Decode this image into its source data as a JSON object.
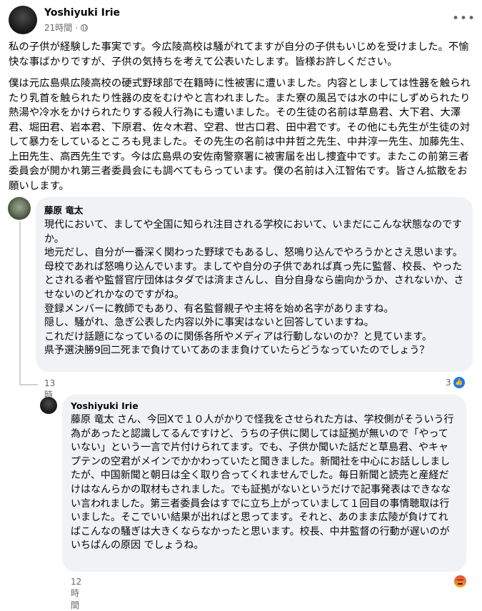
{
  "post": {
    "author": "Yoshiyuki Irie",
    "time": "21時間",
    "more_icon": "ellipsis-icon",
    "paragraphs": [
      "私の子供が経験した事実です。今広陵高校は騒がれてますが自分の子供もいじめを受けました。不愉快な事ばかりですが、子供の気持ちを考えて公表いたします。皆様お許しください。",
      "僕は元広島県広陵高校の硬式野球部で在籍時に性被害に遭いました。内容としましては性器を触られたり乳首を触られたり性器の皮をむけやと言われました。また寮の風呂では水の中にしずめられたり熱湯や冷水をかけられたりする殺人行為にも遭いました。その生徒の名前は草島君、大下君、大澤君、堀田君、岩本君、下原君、佐々木君、空君、世古口君、田中君です。その他にも先生が生徒の対して暴力をしているところも見ました。その先生の名前は中井哲之先生、中井淳一先生、加藤先生、上田先生、高西先生です。今は広島県の安佐南警察署に被害届を出し捜査中です。またこの前第三者委員会が開かれ第三者委員会にも調べてもらっています。僕の名前は入江智佑です。皆さん拡散をお願いします。"
    ]
  },
  "comments": [
    {
      "name": "藤原 竜太",
      "text": "現代において、ましてや全国に知られ注目される学校において、いまだにこんな状態なのですか。\n地元だし、自分が一番深く関わった野球でもあるし、怒鳴り込んでやろうかとさえ思います。母校であれば怒鳴り込んでいます。ましてや自分の子供であれば真っ先に監督、校長、やったとされる者や監督官庁団体はタダでは済まさんし、自分自身なら歯向かうか、されないか、させないのどれかなのですがね。\n登録メンバーに教師でもあり、有名監督親子や主将を始め名字がありますね。\n隠し、騒がれ、急ぎ公表した内容以外に事実はないと回答していますね。\nこれだけ話題になっているのに関係各所やメディアは行動しないのか？と見ています。\n県予選決勝9回二死まで負けていてあのまま負けていたらどうなっていたのでしょう？",
      "time": "13時間",
      "reaction_count": "3",
      "reaction_icon": "like-icon"
    },
    {
      "name": "Yoshiyuki Irie",
      "text": "藤原 竜太 さん、今回Xで１０人がかりで怪我をさせられた方は、学校側がそういう行為があったと認識してるんですけど、うちの子供に関しては証拠が無いので「やっていない」という一言で片付けられてます。でも、子供か聞いた話だと草島君、やキャプテンの空君がメインでかかわっていたと聞きました。新聞社を中心にお話ししましたが、中国新聞と朝日は全く取り合ってくれませんでした。毎日新聞と読売と産経だけはなんらかの取材もされました。でも証拠がないというだけで記事発表はできなない言われました。第三者委員会はすでに立ち上がっていまして１回目の事情聴取は行いました。そこでいい結果が出ればと思ってます。それと、あのまま広陵が負けてればこんなの騒ぎは大きくならなかったと思います。校長、中井監督の行動が遅いのがいちばんの原因 でしょうね。",
      "time": "12時間",
      "reaction_icon": "angry-icon"
    }
  ]
}
